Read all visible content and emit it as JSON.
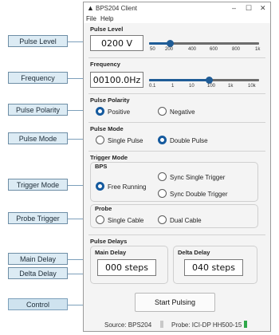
{
  "callouts": [
    {
      "label": "Pulse Level"
    },
    {
      "label": "Frequency"
    },
    {
      "label": "Pulse Polarity"
    },
    {
      "label": "Pulse Mode"
    },
    {
      "label": "Trigger Mode"
    },
    {
      "label": "Probe Trigger"
    },
    {
      "label": "Main Delay"
    },
    {
      "label": "Delta Delay"
    },
    {
      "label": "Control"
    }
  ],
  "window": {
    "title": "BPS204 Client",
    "menu": [
      "File",
      "Help"
    ]
  },
  "pulse_level": {
    "title": "Pulse Level",
    "value": "0200 V",
    "ticks": [
      "50",
      "200",
      "400",
      "600",
      "800",
      "1k"
    ],
    "selected_tick": "200"
  },
  "frequency": {
    "title": "Frequency",
    "value": "00100.0Hz",
    "ticks": [
      "0.1",
      "1",
      "10",
      "100",
      "1k",
      "10k"
    ],
    "selected_tick": "100"
  },
  "pulse_polarity": {
    "title": "Pulse Polarity",
    "options": [
      "Positive",
      "Negative"
    ],
    "selected": "Positive"
  },
  "pulse_mode": {
    "title": "Pulse Mode",
    "options": [
      "Single Pulse",
      "Double Pulse"
    ],
    "selected": "Double Pulse"
  },
  "trigger_mode": {
    "title": "Trigger Mode",
    "bps": {
      "title": "BPS",
      "options": [
        "Free Running",
        "Sync Single Trigger",
        "Sync Double Trigger"
      ],
      "selected": "Free Running"
    },
    "probe": {
      "title": "Probe",
      "options": [
        "Single Cable",
        "Dual Cable"
      ],
      "selected": null
    }
  },
  "pulse_delays": {
    "title": "Pulse Delays",
    "main": {
      "title": "Main Delay",
      "value": "000 steps"
    },
    "delta": {
      "title": "Delta Delay",
      "value": "040 steps"
    }
  },
  "control": {
    "button": "Start Pulsing"
  },
  "status": {
    "source": "Source: BPS204",
    "probe": "Probe: ICI-DP HH500-15",
    "source_color": "#c8c8c8",
    "probe_color": "#2fa84a"
  }
}
